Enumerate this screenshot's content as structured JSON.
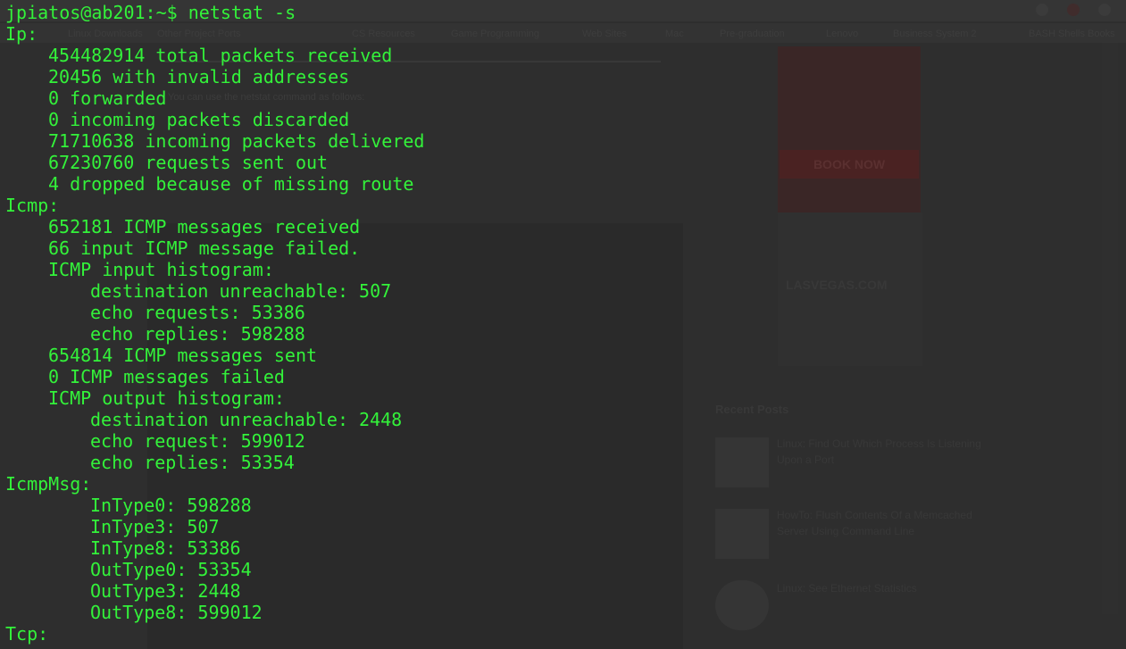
{
  "background_page": {
    "bookmarks": [
      "Linux Downloads",
      "Other Project Ports",
      "CS Resources",
      "Game Programming",
      "Web Sites",
      "Mac",
      "Pre-graduation",
      "Lenovo",
      "Business System 2",
      "BASH Shells Books"
    ],
    "article_intro": "You can use the netstat command as follows:",
    "ad_button": "BOOK NOW",
    "ad_brand": "LASVEGAS.COM",
    "recent_posts_heading": "Recent Posts",
    "recent_posts": [
      "Linux: Find Out Which Process Is Listening Upon a Port",
      "HowTo: Flush Contents Of a Memcached Server Using Command Line",
      "Linux: See Ethernet Statistics"
    ]
  },
  "terminal": {
    "prompt": "jpiatos@ab201:~$ netstat -s",
    "lines": [
      {
        "indent": 0,
        "text": "Ip:"
      },
      {
        "indent": 1,
        "text": "454482914 total packets received"
      },
      {
        "indent": 1,
        "text": "20456 with invalid addresses"
      },
      {
        "indent": 1,
        "text": "0 forwarded"
      },
      {
        "indent": 1,
        "text": "0 incoming packets discarded"
      },
      {
        "indent": 1,
        "text": "71710638 incoming packets delivered"
      },
      {
        "indent": 1,
        "text": "67230760 requests sent out"
      },
      {
        "indent": 1,
        "text": "4 dropped because of missing route"
      },
      {
        "indent": 0,
        "text": "Icmp:"
      },
      {
        "indent": 1,
        "text": "652181 ICMP messages received"
      },
      {
        "indent": 1,
        "text": "66 input ICMP message failed."
      },
      {
        "indent": 1,
        "text": "ICMP input histogram:"
      },
      {
        "indent": 2,
        "text": "destination unreachable: 507"
      },
      {
        "indent": 2,
        "text": "echo requests: 53386"
      },
      {
        "indent": 2,
        "text": "echo replies: 598288"
      },
      {
        "indent": 1,
        "text": "654814 ICMP messages sent"
      },
      {
        "indent": 1,
        "text": "0 ICMP messages failed"
      },
      {
        "indent": 1,
        "text": "ICMP output histogram:"
      },
      {
        "indent": 2,
        "text": "destination unreachable: 2448"
      },
      {
        "indent": 2,
        "text": "echo request: 599012"
      },
      {
        "indent": 2,
        "text": "echo replies: 53354"
      },
      {
        "indent": 0,
        "text": "IcmpMsg:"
      },
      {
        "indent": 2,
        "text": "InType0: 598288"
      },
      {
        "indent": 2,
        "text": "InType3: 507"
      },
      {
        "indent": 2,
        "text": "InType8: 53386"
      },
      {
        "indent": 2,
        "text": "OutType0: 53354"
      },
      {
        "indent": 2,
        "text": "OutType3: 2448"
      },
      {
        "indent": 2,
        "text": "OutType8: 599012"
      },
      {
        "indent": 0,
        "text": "Tcp:"
      }
    ]
  },
  "colors": {
    "terminal_text": "#33f23a",
    "terminal_background": "#2e2e2e"
  }
}
